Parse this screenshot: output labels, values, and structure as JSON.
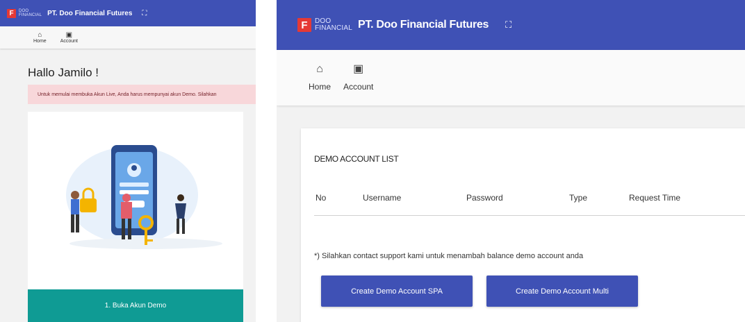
{
  "brand": {
    "logo_letter": "F",
    "logo_line1": "DOO",
    "logo_line2": "FINANCIAL",
    "name": "PT. Doo Financial Futures"
  },
  "nav": [
    {
      "label": "Home",
      "icon": "home-icon"
    },
    {
      "label": "Account",
      "icon": "account-card-icon"
    }
  ],
  "left": {
    "greeting": "Hallo Jamilo !",
    "alert": "Untuk memulai membuka Akun Live, Anda harus mempunyai akun Demo. Silahkan",
    "step_label": "1. Buka Akun Demo"
  },
  "right": {
    "list_title": "DEMO ACCOUNT LIST",
    "columns": [
      "No",
      "Username",
      "Password",
      "Type",
      "Request Time"
    ],
    "note": "*) Silahkan contact support kami untuk menambah balance demo account anda",
    "buttons": {
      "spa": "Create Demo Account SPA",
      "multi": "Create Demo Account Multi"
    }
  },
  "colors": {
    "header": "#3f51b5",
    "alert_bg": "#f8d7da",
    "step_bg": "#0f9b94",
    "button": "#3f51b5"
  }
}
